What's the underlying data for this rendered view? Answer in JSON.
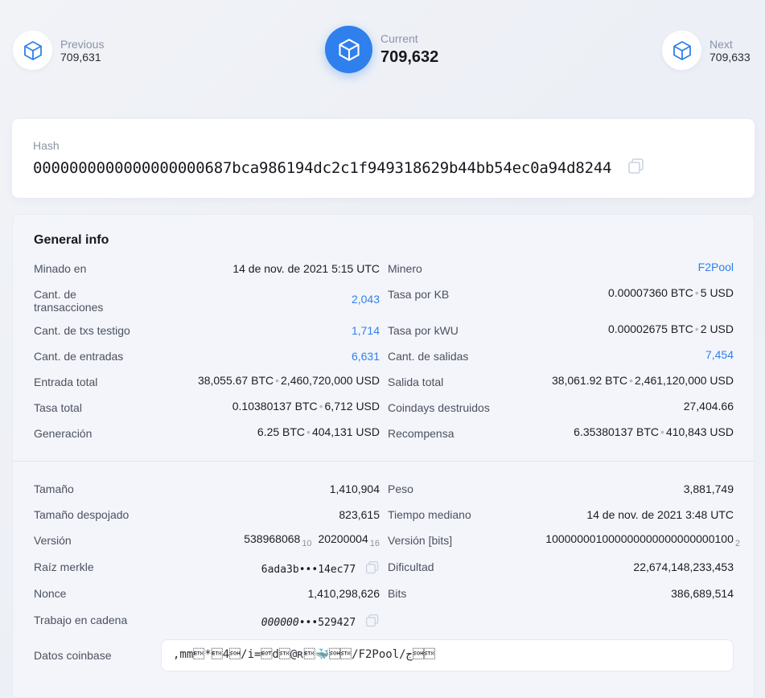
{
  "nav": {
    "previous": {
      "label": "Previous",
      "value": "709,631"
    },
    "current": {
      "label": "Current",
      "value": "709,632"
    },
    "next": {
      "label": "Next",
      "value": "709,633"
    }
  },
  "hash": {
    "label": "Hash",
    "value": "0000000000000000000687bca986194dc2c1f949318629b44bb54ec0a94d8244"
  },
  "general": {
    "title": "General info",
    "left": [
      {
        "label": "Minado en",
        "value": "14 de nov. de 2021 5:15 UTC"
      },
      {
        "label": "Cant. de transacciones",
        "value": "2,043"
      },
      {
        "label": "Cant. de txs testigo",
        "value": "1,714"
      },
      {
        "label": "Cant. de entradas",
        "value": "6,631"
      },
      {
        "label": "Entrada total",
        "btc": "38,055.67 BTC",
        "usd": "2,460,720,000 USD"
      },
      {
        "label": "Tasa total",
        "btc": "0.10380137 BTC",
        "usd": "6,712 USD"
      },
      {
        "label": "Generación",
        "btc": "6.25 BTC",
        "usd": "404,131 USD"
      }
    ],
    "right": [
      {
        "label": "Minero",
        "value": "F2Pool"
      },
      {
        "label": "Tasa por KB",
        "btc": "0.00007360 BTC",
        "usd": "5 USD"
      },
      {
        "label": "Tasa por kWU",
        "btc": "0.00002675 BTC",
        "usd": "2 USD"
      },
      {
        "label": "Cant. de salidas",
        "value": "7,454"
      },
      {
        "label": "Salida total",
        "btc": "38,061.92 BTC",
        "usd": "2,461,120,000 USD"
      },
      {
        "label": "Coindays destruidos",
        "value": "27,404.66"
      },
      {
        "label": "Recompensa",
        "btc": "6.35380137 BTC",
        "usd": "410,843 USD"
      }
    ]
  },
  "details": {
    "left": [
      {
        "label": "Tamaño",
        "value": "1,410,904"
      },
      {
        "label": "Tamaño despojado",
        "value": "823,615"
      },
      {
        "label": "Versión",
        "dec": "538968068",
        "dec_base": "10",
        "hex": "20200004",
        "hex_base": "16"
      },
      {
        "label": "Raíz merkle",
        "start": "6ada3b",
        "end": "14ec77"
      },
      {
        "label": "Nonce",
        "value": "1,410,298,626"
      },
      {
        "label": "Trabajo en cadena",
        "start": "000000",
        "end": "529427"
      }
    ],
    "right": [
      {
        "label": "Peso",
        "value": "3,881,749"
      },
      {
        "label": "Tiempo mediano",
        "value": "14 de nov. de 2021 3:48 UTC"
      },
      {
        "label": "Versión [bits]",
        "value": "100000001000000000000000000100",
        "base": "2"
      },
      {
        "label": "Dificultad",
        "value": "22,674,148,233,453"
      },
      {
        "label": "Bits",
        "value": "386,689,514"
      }
    ],
    "coinbase": {
      "label": "Datos coinbase",
      "value": ",mm\u0003*\u00034\u0001/i=\u0004d\u0002@ʀ\u0003🐳\u0001\u0002/F2Pool/ج\u0001\u0002"
    }
  },
  "separator": "•",
  "ellipsis": "•••",
  "colors": {
    "accent": "#2f80ed",
    "link": "#2f80ed",
    "muted": "#8a94a6"
  },
  "icons": {
    "block": "cube-icon",
    "copy": "copy-icon"
  }
}
